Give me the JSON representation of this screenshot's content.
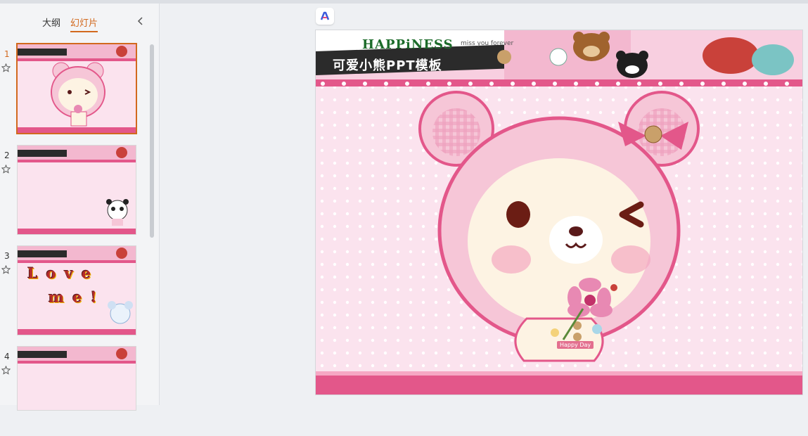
{
  "sidebar": {
    "tabs": [
      {
        "label": "大纲",
        "active": false
      },
      {
        "label": "幻灯片",
        "active": true
      }
    ],
    "slides": [
      {
        "number": "1",
        "active": true,
        "overlay": null
      },
      {
        "number": "2",
        "active": false,
        "overlay": null
      },
      {
        "number": "3",
        "active": false,
        "overlay": {
          "line1": "Love",
          "line2": "me!"
        }
      },
      {
        "number": "4",
        "active": false,
        "overlay": null
      }
    ]
  },
  "slide": {
    "title": "可爱小熊PPT模板",
    "header_word": "HAPPiNESS",
    "header_sub": "miss you forever",
    "badge_text": "Happy Day"
  },
  "colors": {
    "accent": "#d2691e",
    "slide_pink": "#fbe3ee",
    "lace": "#e3578a",
    "bear_face": "#fdf3e3"
  },
  "icons": {
    "collapse": "chevron-left-icon",
    "star": "star-outline-icon",
    "ai": "ai-logo-icon"
  }
}
